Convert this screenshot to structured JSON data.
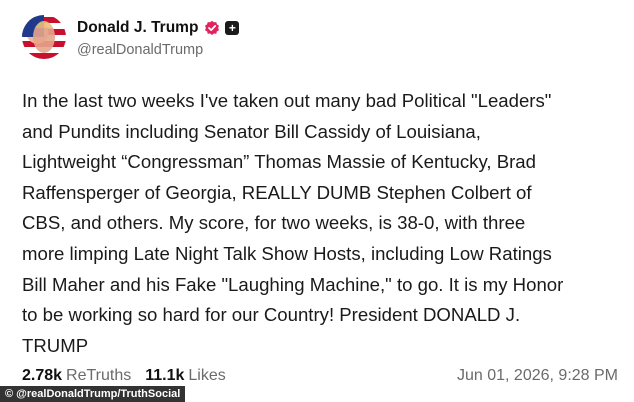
{
  "author": {
    "display_name": "Donald J. Trump",
    "handle": "@realDonaldTrump",
    "verified_color": "#e0245e"
  },
  "post": {
    "text": "In the last two weeks I've taken out many bad Political \"Leaders\"\nand Pundits including Senator Bill Cassidy of Louisiana,\nLightweight “Congressman” Thomas Massie of Kentucky, Brad\nRaffensperger of Georgia, REALLY DUMB Stephen Colbert of\nCBS, and others. My score, for two weeks, is 38-0, with three\nmore limping Late Night Talk Show Hosts, including Low Ratings\nBill Maher and his Fake \"Laughing Machine,\" to go. It is my Honor\nto be working so hard for our Country! President DONALD J.\nTRUMP"
  },
  "stats": {
    "retruths_count": "2.78k",
    "retruths_label": "ReTruths",
    "likes_count": "11.1k",
    "likes_label": "Likes",
    "timestamp": "Jun 01, 2026, 9:28 PM"
  },
  "credit": "© @realDonaldTrump/TruthSocial"
}
